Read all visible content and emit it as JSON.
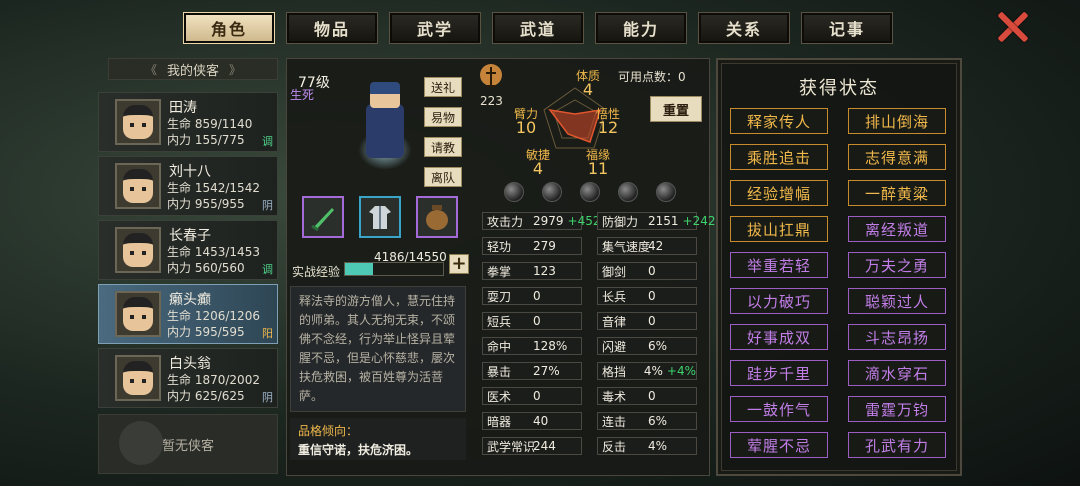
{
  "tabs": [
    "角色",
    "物品",
    "武学",
    "武道",
    "能力",
    "关系",
    "记事"
  ],
  "list_header": "我的侠客",
  "heroes": [
    {
      "name": "田涛",
      "hp_label": "生命",
      "hp": "859/1140",
      "mp_label": "内力",
      "mp": "155/775",
      "tag": "调",
      "tag_color": "#4ed28a"
    },
    {
      "name": "刘十八",
      "hp_label": "生命",
      "hp": "1542/1542",
      "mp_label": "内力",
      "mp": "955/955",
      "tag": "阴",
      "tag_color": "#9fb4c8"
    },
    {
      "name": "长春子",
      "hp_label": "生命",
      "hp": "1453/1453",
      "mp_label": "内力",
      "mp": "560/560",
      "tag": "调",
      "tag_color": "#4ed28a"
    },
    {
      "name": "癞头癫",
      "hp_label": "生命",
      "hp": "1206/1206",
      "mp_label": "内力",
      "mp": "595/595",
      "tag": "阳",
      "tag_color": "#f0b84a"
    },
    {
      "name": "白头翁",
      "hp_label": "生命",
      "hp": "1870/2002",
      "mp_label": "内力",
      "mp": "625/625",
      "tag": "阴",
      "tag_color": "#9fb4c8"
    }
  ],
  "empty_slot": "暂无侠客",
  "character": {
    "level": "77级",
    "sect": "生死"
  },
  "side_buttons": [
    "送礼",
    "易物",
    "请教",
    "离队"
  ],
  "xp": {
    "label": "实战经验",
    "value": "4186/14550",
    "fraction": 0.288
  },
  "bio": "释法寺的游方僧人，慧元住持的师弟。其人无拘无束，不颂佛不念经，行为举止怪异且荤腥不忌，但是心怀慈悲，屡次扶危救困，被百姓尊为活菩萨。",
  "trait": {
    "title": "品格倾向：",
    "text": "重信守诺，扶危济困。"
  },
  "bonus_value": "223",
  "points": "可用点数：0",
  "reset": "重置",
  "attrs": [
    {
      "label": "体质",
      "value": "4"
    },
    {
      "label": "臂力",
      "value": "10"
    },
    {
      "label": "悟性",
      "value": "12"
    },
    {
      "label": "敏捷",
      "value": "4"
    },
    {
      "label": "福缘",
      "value": "11"
    }
  ],
  "stats_left": [
    {
      "k": "攻击力",
      "v": "2979",
      "g": "+452"
    },
    {
      "k": "轻功",
      "v": "279",
      "g": ""
    },
    {
      "k": "拳掌",
      "v": "123",
      "g": ""
    },
    {
      "k": "耍刀",
      "v": "0",
      "g": ""
    },
    {
      "k": "短兵",
      "v": "0",
      "g": ""
    },
    {
      "k": "命中",
      "v": "128%",
      "g": ""
    },
    {
      "k": "暴击",
      "v": "27%",
      "g": ""
    },
    {
      "k": "医术",
      "v": "0",
      "g": ""
    },
    {
      "k": "暗器",
      "v": "40",
      "g": ""
    },
    {
      "k": "武学常识",
      "v": "244",
      "g": ""
    }
  ],
  "stats_right": [
    {
      "k": "防御力",
      "v": "2151",
      "g": "+242"
    },
    {
      "k": "集气速度",
      "v": "42",
      "g": ""
    },
    {
      "k": "御剑",
      "v": "0",
      "g": ""
    },
    {
      "k": "长兵",
      "v": "0",
      "g": ""
    },
    {
      "k": "音律",
      "v": "0",
      "g": ""
    },
    {
      "k": "闪避",
      "v": "6%",
      "g": ""
    },
    {
      "k": "格挡",
      "v": "4%",
      "g": "+4%"
    },
    {
      "k": "毒术",
      "v": "0",
      "g": ""
    },
    {
      "k": "连击",
      "v": "6%",
      "g": ""
    },
    {
      "k": "反击",
      "v": "4%",
      "g": ""
    }
  ],
  "status_title": "获得状态",
  "statuses": [
    {
      "label": "释家传人",
      "purple": false
    },
    {
      "label": "排山倒海",
      "purple": false
    },
    {
      "label": "乘胜追击",
      "purple": false
    },
    {
      "label": "志得意满",
      "purple": false
    },
    {
      "label": "经验增幅",
      "purple": false
    },
    {
      "label": "一醉黄粱",
      "purple": false
    },
    {
      "label": "拔山扛鼎",
      "purple": false
    },
    {
      "label": "离经叛道",
      "purple": true
    },
    {
      "label": "举重若轻",
      "purple": true
    },
    {
      "label": "万夫之勇",
      "purple": true
    },
    {
      "label": "以力破巧",
      "purple": true
    },
    {
      "label": "聪颖过人",
      "purple": true
    },
    {
      "label": "好事成双",
      "purple": true
    },
    {
      "label": "斗志昂扬",
      "purple": true
    },
    {
      "label": "跬步千里",
      "purple": true
    },
    {
      "label": "滴水穿石",
      "purple": true
    },
    {
      "label": "一鼓作气",
      "purple": true
    },
    {
      "label": "雷霆万钧",
      "purple": true
    },
    {
      "label": "荤腥不忌",
      "purple": true
    },
    {
      "label": "孔武有力",
      "purple": true
    }
  ],
  "icons": {
    "close": "close-icon",
    "weapon": "sword-icon",
    "armor": "robe-icon",
    "item": "jar-icon",
    "bonus": "figure-icon"
  }
}
